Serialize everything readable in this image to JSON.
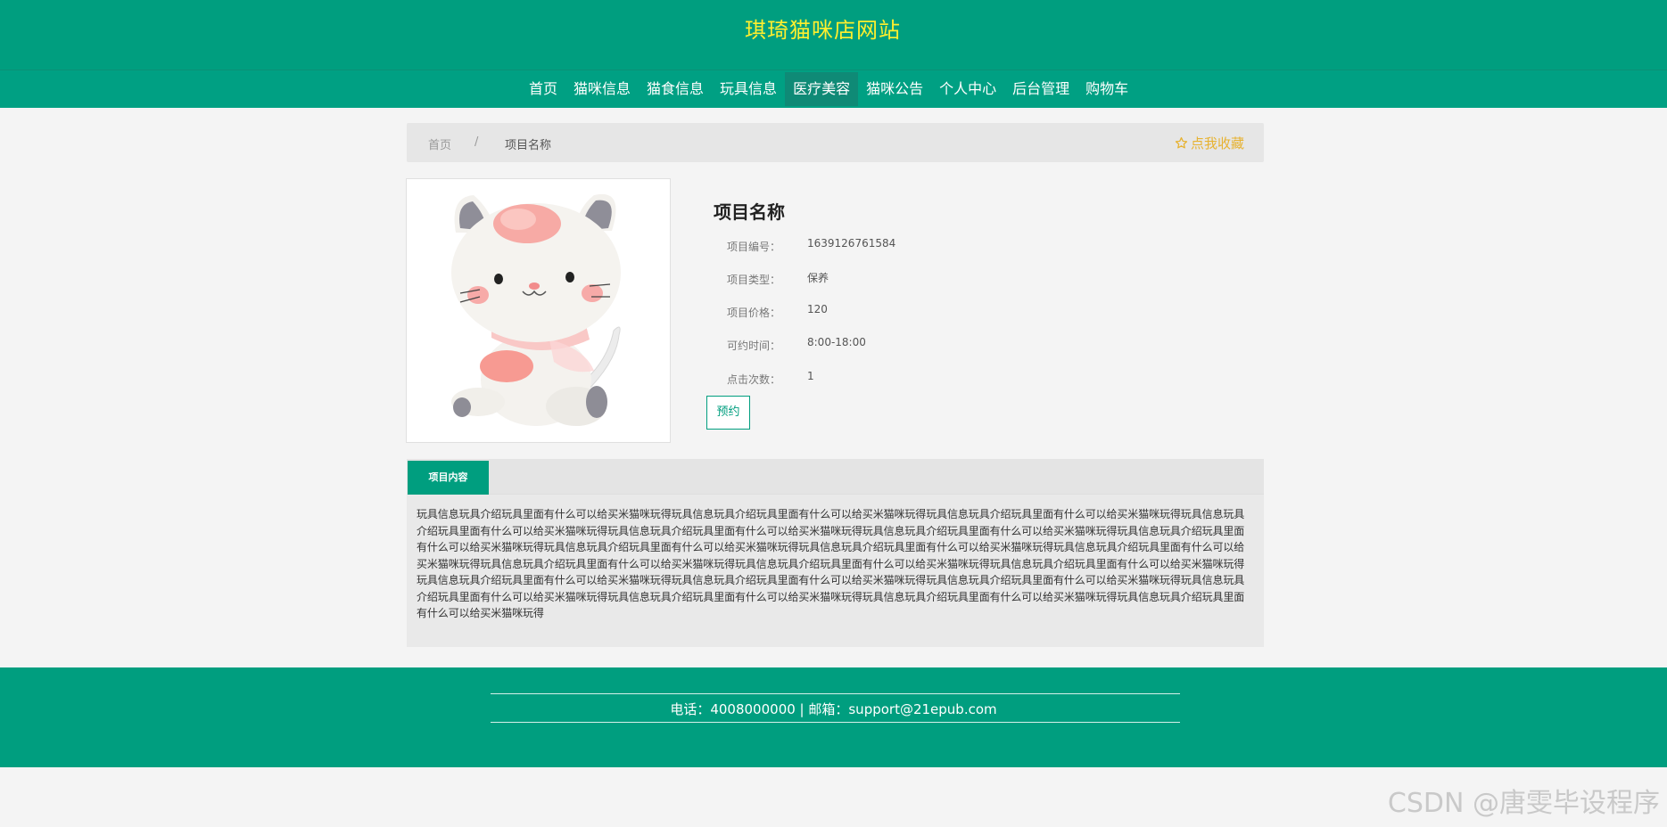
{
  "site": {
    "title": "琪琦猫咪店网站"
  },
  "nav": {
    "items": [
      {
        "label": "首页",
        "active": false
      },
      {
        "label": "猫咪信息",
        "active": false
      },
      {
        "label": "猫食信息",
        "active": false
      },
      {
        "label": "玩具信息",
        "active": false
      },
      {
        "label": "医疗美容",
        "active": true
      },
      {
        "label": "猫咪公告",
        "active": false
      },
      {
        "label": "个人中心",
        "active": false
      },
      {
        "label": "后台管理",
        "active": false
      },
      {
        "label": "购物车",
        "active": false
      }
    ]
  },
  "breadcrumb": {
    "home": "首页",
    "separator": "/",
    "current": "项目名称"
  },
  "favorite": {
    "label": "点我收藏",
    "icon": "star-icon"
  },
  "image": {
    "alt_icon": "plush-cat-toy-image"
  },
  "detail": {
    "title": "项目名称",
    "fields": [
      {
        "label": "项目编号：",
        "value": "1639126761584"
      },
      {
        "label": "项目类型：",
        "value": "保养"
      },
      {
        "label": "项目价格：",
        "value": "120"
      },
      {
        "label": "可约时间：",
        "value": "8:00-18:00"
      },
      {
        "label": "点击次数：",
        "value": "1"
      }
    ],
    "book_button": "预约"
  },
  "tabs": {
    "active": "项目内容",
    "content": "玩具信息玩具介绍玩具里面有什么可以给买米猫咪玩得玩具信息玩具介绍玩具里面有什么可以给买米猫咪玩得玩具信息玩具介绍玩具里面有什么可以给买米猫咪玩得玩具信息玩具介绍玩具里面有什么可以给买米猫咪玩得玩具信息玩具介绍玩具里面有什么可以给买米猫咪玩得玩具信息玩具介绍玩具里面有什么可以给买米猫咪玩得玩具信息玩具介绍玩具里面有什么可以给买米猫咪玩得玩具信息玩具介绍玩具里面有什么可以给买米猫咪玩得玩具信息玩具介绍玩具里面有什么可以给买米猫咪玩得玩具信息玩具介绍玩具里面有什么可以给买米猫咪玩得玩具信息玩具介绍玩具里面有什么可以给买米猫咪玩得玩具信息玩具介绍玩具里面有什么可以给买米猫咪玩得玩具信息玩具介绍玩具里面有什么可以给买米猫咪玩得玩具信息玩具介绍玩具里面有什么可以给买米猫咪玩得玩具信息玩具介绍玩具里面有什么可以给买米猫咪玩得玩具信息玩具介绍玩具里面有什么可以给买米猫咪玩得玩具信息玩具介绍玩具里面有什么可以给买米猫咪玩得玩具信息玩具介绍玩具里面有什么可以给买米猫咪玩得玩具信息玩具介绍玩具里面有什么可以给买米猫咪玩得玩具信息玩具介绍玩具里面有什么可以给买米猫咪玩得"
  },
  "footer": {
    "contact": "电话：4008000000 | 邮箱：support@21epub.com"
  },
  "watermark": "CSDN @唐雯毕设程序",
  "colors": {
    "primary": "#009e7f",
    "title": "#ffef2e",
    "favorite": "#e7b230"
  }
}
